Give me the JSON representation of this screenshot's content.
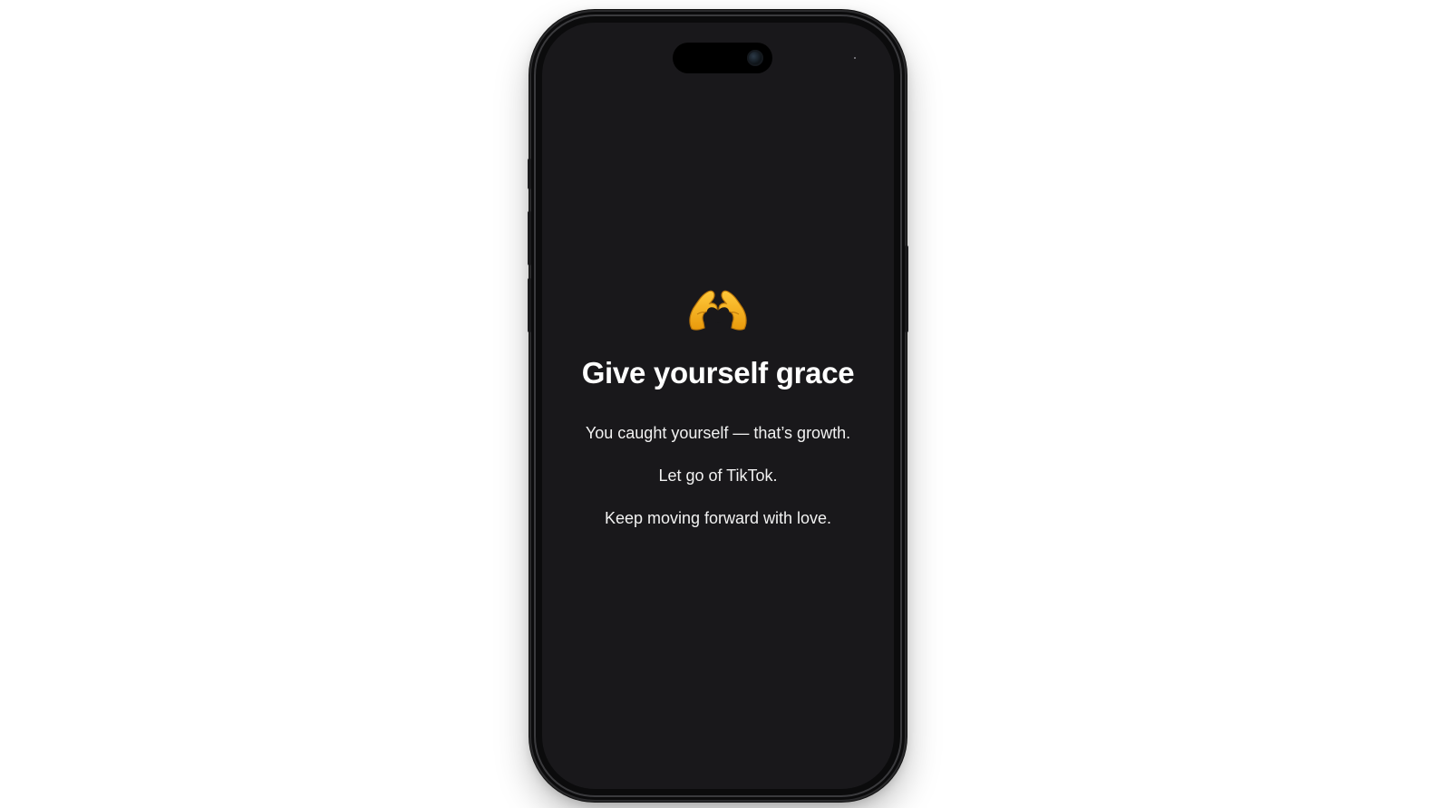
{
  "screen": {
    "emoji_icon": "heart-hands-emoji",
    "emoji_color": "#F5B118",
    "title": "Give yourself grace",
    "message_lines": [
      "You caught yourself — that’s growth.",
      "Let go of TikTok.",
      "Keep moving forward with love."
    ],
    "background_color": "#19181B",
    "text_color": "#FFFFFF"
  }
}
